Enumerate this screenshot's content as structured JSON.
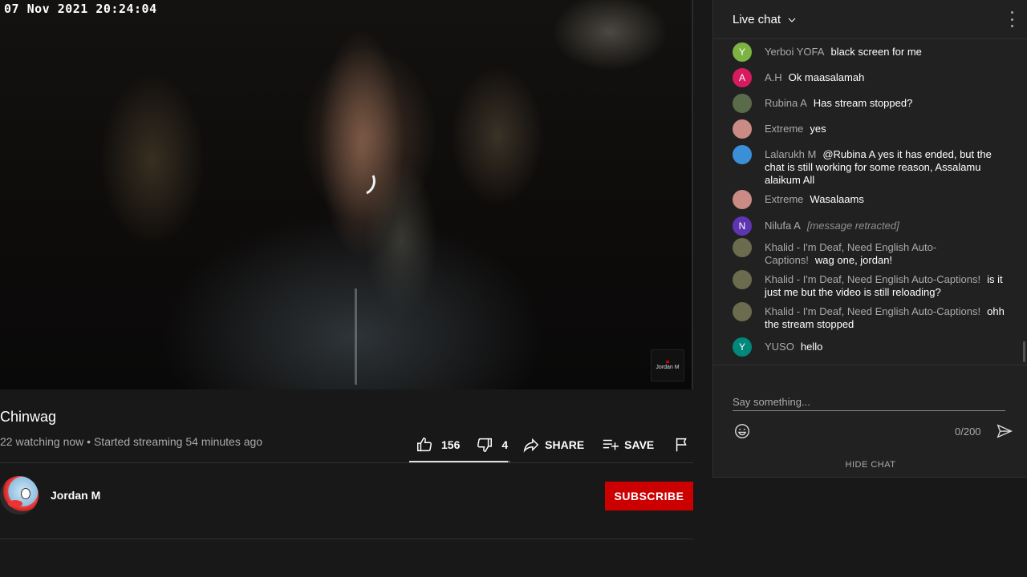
{
  "video": {
    "timestamp": "07 Nov 2021 20:24:04",
    "watermark": "Jordan M"
  },
  "title": "Chinwag",
  "meta": "22 watching now • Started streaming 54 minutes ago",
  "actions": {
    "likes": "156",
    "dislikes": "4",
    "share_label": "SHARE",
    "save_label": "SAVE",
    "like_ratio": 0.975
  },
  "channel": {
    "name": "Jordan M",
    "subscribe_label": "SUBSCRIBE"
  },
  "chat": {
    "title": "Live chat",
    "messages": [
      {
        "initial": "Y",
        "color": "#7cb342",
        "author": "Yerboi YOFA",
        "text": "black screen for me"
      },
      {
        "initial": "A",
        "color": "#d81b60",
        "author": "A.H",
        "text": "Ok maasalamah"
      },
      {
        "initial": "",
        "color": "#5a6b4a",
        "author": "Rubina A",
        "text": "Has stream stopped?"
      },
      {
        "initial": "",
        "color": "#c98b84",
        "author": "Extreme",
        "text": "yes"
      },
      {
        "initial": "",
        "color": "#3b8fd6",
        "author": "Lalarukh M",
        "text": "@Rubina A yes it has ended, but the chat is still working for some reason, Assalamu alaikum All"
      },
      {
        "initial": "",
        "color": "#c98b84",
        "author": "Extreme",
        "text": "Wasalaams"
      },
      {
        "initial": "N",
        "color": "#5e35b1",
        "author": "Nilufa A",
        "text": "[message retracted]"
      },
      {
        "initial": "",
        "color": "#6b6b4e",
        "author": "Khalid - I'm Deaf, Need English Auto-Captions!",
        "text": "wag one, jordan!"
      },
      {
        "initial": "",
        "color": "#6b6b4e",
        "author": "Khalid - I'm Deaf, Need English Auto-Captions!",
        "text": "is it just me but the video is still reloading?"
      },
      {
        "initial": "",
        "color": "#6b6b4e",
        "author": "Khalid - I'm Deaf, Need English Auto-Captions!",
        "text": "ohh the stream stopped"
      },
      {
        "initial": "Y",
        "color": "#00897b",
        "author": "YUSO",
        "text": "hello"
      }
    ],
    "input_placeholder": "Say something...",
    "char_count": "0/200",
    "hide_label": "HIDE CHAT"
  }
}
